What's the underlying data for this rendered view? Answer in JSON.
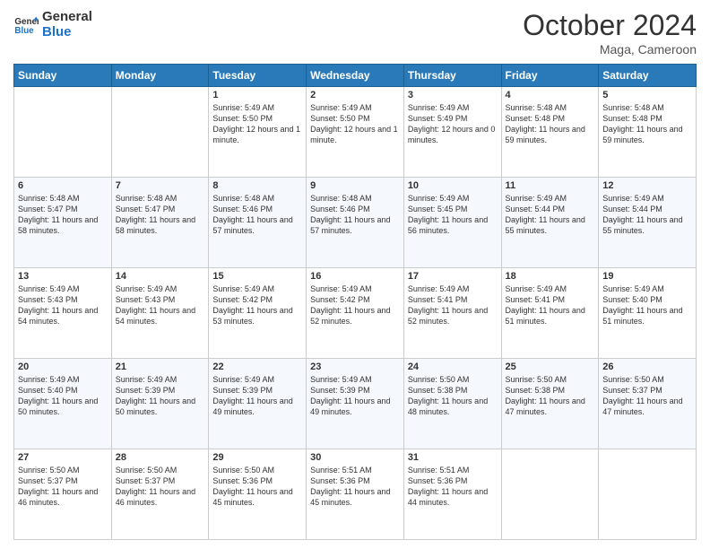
{
  "logo": {
    "line1": "General",
    "line2": "Blue"
  },
  "header": {
    "month": "October 2024",
    "location": "Maga, Cameroon"
  },
  "weekdays": [
    "Sunday",
    "Monday",
    "Tuesday",
    "Wednesday",
    "Thursday",
    "Friday",
    "Saturday"
  ],
  "weeks": [
    [
      {
        "day": "",
        "sunrise": "",
        "sunset": "",
        "daylight": ""
      },
      {
        "day": "",
        "sunrise": "",
        "sunset": "",
        "daylight": ""
      },
      {
        "day": "1",
        "sunrise": "Sunrise: 5:49 AM",
        "sunset": "Sunset: 5:50 PM",
        "daylight": "Daylight: 12 hours and 1 minute."
      },
      {
        "day": "2",
        "sunrise": "Sunrise: 5:49 AM",
        "sunset": "Sunset: 5:50 PM",
        "daylight": "Daylight: 12 hours and 1 minute."
      },
      {
        "day": "3",
        "sunrise": "Sunrise: 5:49 AM",
        "sunset": "Sunset: 5:49 PM",
        "daylight": "Daylight: 12 hours and 0 minutes."
      },
      {
        "day": "4",
        "sunrise": "Sunrise: 5:48 AM",
        "sunset": "Sunset: 5:48 PM",
        "daylight": "Daylight: 11 hours and 59 minutes."
      },
      {
        "day": "5",
        "sunrise": "Sunrise: 5:48 AM",
        "sunset": "Sunset: 5:48 PM",
        "daylight": "Daylight: 11 hours and 59 minutes."
      }
    ],
    [
      {
        "day": "6",
        "sunrise": "Sunrise: 5:48 AM",
        "sunset": "Sunset: 5:47 PM",
        "daylight": "Daylight: 11 hours and 58 minutes."
      },
      {
        "day": "7",
        "sunrise": "Sunrise: 5:48 AM",
        "sunset": "Sunset: 5:47 PM",
        "daylight": "Daylight: 11 hours and 58 minutes."
      },
      {
        "day": "8",
        "sunrise": "Sunrise: 5:48 AM",
        "sunset": "Sunset: 5:46 PM",
        "daylight": "Daylight: 11 hours and 57 minutes."
      },
      {
        "day": "9",
        "sunrise": "Sunrise: 5:48 AM",
        "sunset": "Sunset: 5:46 PM",
        "daylight": "Daylight: 11 hours and 57 minutes."
      },
      {
        "day": "10",
        "sunrise": "Sunrise: 5:49 AM",
        "sunset": "Sunset: 5:45 PM",
        "daylight": "Daylight: 11 hours and 56 minutes."
      },
      {
        "day": "11",
        "sunrise": "Sunrise: 5:49 AM",
        "sunset": "Sunset: 5:44 PM",
        "daylight": "Daylight: 11 hours and 55 minutes."
      },
      {
        "day": "12",
        "sunrise": "Sunrise: 5:49 AM",
        "sunset": "Sunset: 5:44 PM",
        "daylight": "Daylight: 11 hours and 55 minutes."
      }
    ],
    [
      {
        "day": "13",
        "sunrise": "Sunrise: 5:49 AM",
        "sunset": "Sunset: 5:43 PM",
        "daylight": "Daylight: 11 hours and 54 minutes."
      },
      {
        "day": "14",
        "sunrise": "Sunrise: 5:49 AM",
        "sunset": "Sunset: 5:43 PM",
        "daylight": "Daylight: 11 hours and 54 minutes."
      },
      {
        "day": "15",
        "sunrise": "Sunrise: 5:49 AM",
        "sunset": "Sunset: 5:42 PM",
        "daylight": "Daylight: 11 hours and 53 minutes."
      },
      {
        "day": "16",
        "sunrise": "Sunrise: 5:49 AM",
        "sunset": "Sunset: 5:42 PM",
        "daylight": "Daylight: 11 hours and 52 minutes."
      },
      {
        "day": "17",
        "sunrise": "Sunrise: 5:49 AM",
        "sunset": "Sunset: 5:41 PM",
        "daylight": "Daylight: 11 hours and 52 minutes."
      },
      {
        "day": "18",
        "sunrise": "Sunrise: 5:49 AM",
        "sunset": "Sunset: 5:41 PM",
        "daylight": "Daylight: 11 hours and 51 minutes."
      },
      {
        "day": "19",
        "sunrise": "Sunrise: 5:49 AM",
        "sunset": "Sunset: 5:40 PM",
        "daylight": "Daylight: 11 hours and 51 minutes."
      }
    ],
    [
      {
        "day": "20",
        "sunrise": "Sunrise: 5:49 AM",
        "sunset": "Sunset: 5:40 PM",
        "daylight": "Daylight: 11 hours and 50 minutes."
      },
      {
        "day": "21",
        "sunrise": "Sunrise: 5:49 AM",
        "sunset": "Sunset: 5:39 PM",
        "daylight": "Daylight: 11 hours and 50 minutes."
      },
      {
        "day": "22",
        "sunrise": "Sunrise: 5:49 AM",
        "sunset": "Sunset: 5:39 PM",
        "daylight": "Daylight: 11 hours and 49 minutes."
      },
      {
        "day": "23",
        "sunrise": "Sunrise: 5:49 AM",
        "sunset": "Sunset: 5:39 PM",
        "daylight": "Daylight: 11 hours and 49 minutes."
      },
      {
        "day": "24",
        "sunrise": "Sunrise: 5:50 AM",
        "sunset": "Sunset: 5:38 PM",
        "daylight": "Daylight: 11 hours and 48 minutes."
      },
      {
        "day": "25",
        "sunrise": "Sunrise: 5:50 AM",
        "sunset": "Sunset: 5:38 PM",
        "daylight": "Daylight: 11 hours and 47 minutes."
      },
      {
        "day": "26",
        "sunrise": "Sunrise: 5:50 AM",
        "sunset": "Sunset: 5:37 PM",
        "daylight": "Daylight: 11 hours and 47 minutes."
      }
    ],
    [
      {
        "day": "27",
        "sunrise": "Sunrise: 5:50 AM",
        "sunset": "Sunset: 5:37 PM",
        "daylight": "Daylight: 11 hours and 46 minutes."
      },
      {
        "day": "28",
        "sunrise": "Sunrise: 5:50 AM",
        "sunset": "Sunset: 5:37 PM",
        "daylight": "Daylight: 11 hours and 46 minutes."
      },
      {
        "day": "29",
        "sunrise": "Sunrise: 5:50 AM",
        "sunset": "Sunset: 5:36 PM",
        "daylight": "Daylight: 11 hours and 45 minutes."
      },
      {
        "day": "30",
        "sunrise": "Sunrise: 5:51 AM",
        "sunset": "Sunset: 5:36 PM",
        "daylight": "Daylight: 11 hours and 45 minutes."
      },
      {
        "day": "31",
        "sunrise": "Sunrise: 5:51 AM",
        "sunset": "Sunset: 5:36 PM",
        "daylight": "Daylight: 11 hours and 44 minutes."
      },
      {
        "day": "",
        "sunrise": "",
        "sunset": "",
        "daylight": ""
      },
      {
        "day": "",
        "sunrise": "",
        "sunset": "",
        "daylight": ""
      }
    ]
  ]
}
